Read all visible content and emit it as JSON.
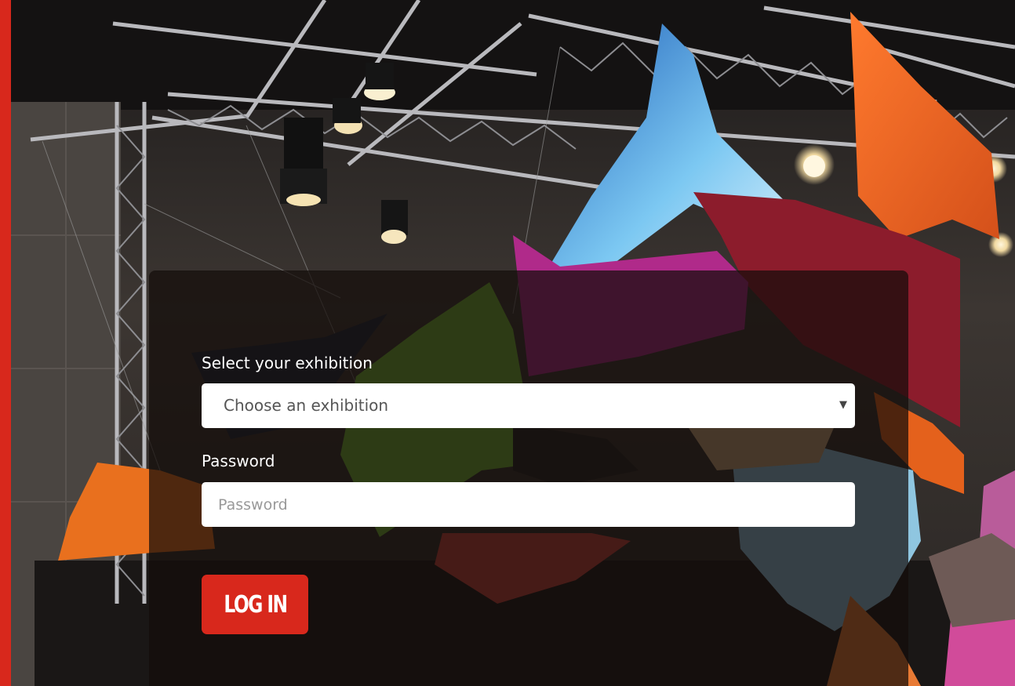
{
  "theme": {
    "accent": "#d8281c",
    "panel_background": "rgba(20, 12, 10, 0.72)",
    "input_background": "#ffffff"
  },
  "background": {
    "icon": "exhibition-hall-photo"
  },
  "login_form": {
    "exhibition_label": "Select your exhibition",
    "exhibition_select": {
      "selected": "Choose an exhibition",
      "caret": "▼"
    },
    "password_label": "Password",
    "password_placeholder": "Password",
    "login_button_label": "LOG IN"
  }
}
